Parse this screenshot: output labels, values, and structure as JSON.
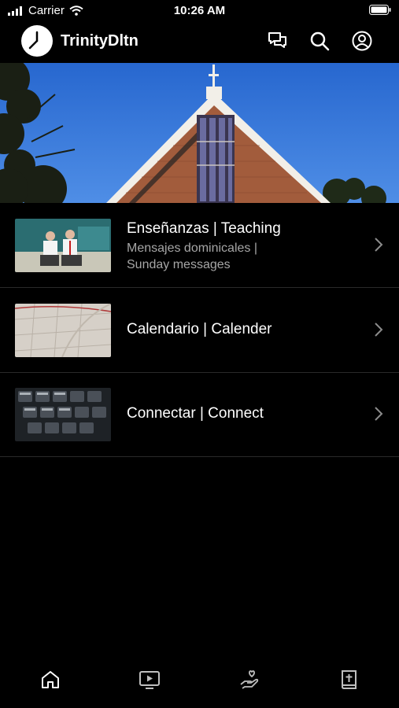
{
  "status": {
    "carrier": "Carrier",
    "time": "10:26 AM"
  },
  "app": {
    "title": "TrinityDltn"
  },
  "header_icons": [
    "chat-icon",
    "search-icon",
    "account-icon"
  ],
  "rows": [
    {
      "title": "Enseñanzas | Teaching",
      "subtitle_line1": "Mensajes dominicales |",
      "subtitle_line2": "Sunday messages"
    },
    {
      "title": "Calendario | Calender"
    },
    {
      "title": "Connectar | Connect"
    }
  ],
  "tabs": [
    "home-icon",
    "video-icon",
    "giving-icon",
    "bible-icon"
  ],
  "colors": {
    "background": "#000000",
    "text": "#ffffff",
    "subtitle": "#a6a6a6",
    "divider": "#2a2a2a",
    "sky": "#2e6fd4",
    "brick": "#a25c3c"
  }
}
